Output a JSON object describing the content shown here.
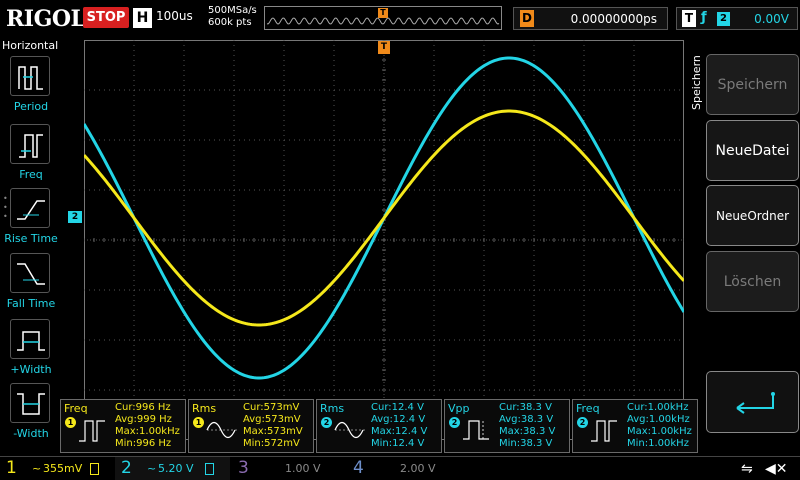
{
  "brand": "RIGOL",
  "run_state": "STOP",
  "horizontal": {
    "label": "H",
    "timebase": "100us",
    "sample_rate": "500MSa/s",
    "memory_depth": "600k pts"
  },
  "trigger_bar": {
    "marker": "T"
  },
  "delay": {
    "label": "D",
    "value": "0.00000000ps"
  },
  "trigger": {
    "label": "T",
    "edge": "ƒ",
    "source": "2",
    "level": "0.00V"
  },
  "left_menu": {
    "title": "Horizontal",
    "items": [
      {
        "label": "Period"
      },
      {
        "label": "Freq"
      },
      {
        "label": "Rise Time"
      },
      {
        "label": "Fall Time"
      },
      {
        "label": "+Width"
      },
      {
        "label": "-Width"
      }
    ]
  },
  "markers": {
    "ch2": "2",
    "trigger_level": "T",
    "trigger_pos": "T"
  },
  "right_menu": {
    "title": "Speichern",
    "buttons": [
      {
        "label": "Speichern",
        "state": "disabled"
      },
      {
        "label": "NeueDatei",
        "state": "enabled"
      },
      {
        "label": "NeueOrdner",
        "state": "enabled"
      },
      {
        "label": "Löschen",
        "state": "disabled"
      }
    ],
    "return_icon": "return-arrow-icon"
  },
  "measurements": [
    {
      "name": "Freq",
      "channel": "1",
      "cur": "Cur:996 Hz",
      "avg": "Avg:999 Hz",
      "max": "Max:1.00kHz",
      "min": "Min:996 Hz"
    },
    {
      "name": "Rms",
      "channel": "1",
      "cur": "Cur:573mV",
      "avg": "Avg:573mV",
      "max": "Max:573mV",
      "min": "Min:572mV"
    },
    {
      "name": "Rms",
      "channel": "2",
      "cur": "Cur:12.4 V",
      "avg": "Avg:12.4 V",
      "max": "Max:12.4 V",
      "min": "Min:12.4 V"
    },
    {
      "name": "Vpp",
      "channel": "2",
      "cur": "Cur:38.3 V",
      "avg": "Avg:38.3 V",
      "max": "Max:38.3 V",
      "min": "Min:38.3 V"
    },
    {
      "name": "Freq",
      "channel": "2",
      "cur": "Cur:1.00kHz",
      "avg": "Avg:1.00kHz",
      "max": "Max:1.00kHz",
      "min": "Min:1.00kHz"
    }
  ],
  "channels": [
    {
      "num": "1",
      "coupling": "~",
      "scale": "355mV",
      "active": true,
      "color": "#f5e81b"
    },
    {
      "num": "2",
      "coupling": "~",
      "scale": "5.20 V",
      "active": true,
      "color": "#23d5e6"
    },
    {
      "num": "3",
      "coupling": "",
      "scale": "1.00 V",
      "active": false,
      "color": "#8a6bb0"
    },
    {
      "num": "4",
      "coupling": "",
      "scale": "2.00 V",
      "active": false,
      "color": "#6d8ec9"
    }
  ],
  "colors": {
    "ch1": "#f5e81b",
    "ch2": "#23d5e6",
    "trigger": "#f08a1a",
    "stop": "#d82020"
  },
  "waveforms": {
    "ch1": {
      "color": "#f5e81b",
      "shape": "sine"
    },
    "ch2": {
      "color": "#23d5e6",
      "shape": "sine"
    }
  }
}
